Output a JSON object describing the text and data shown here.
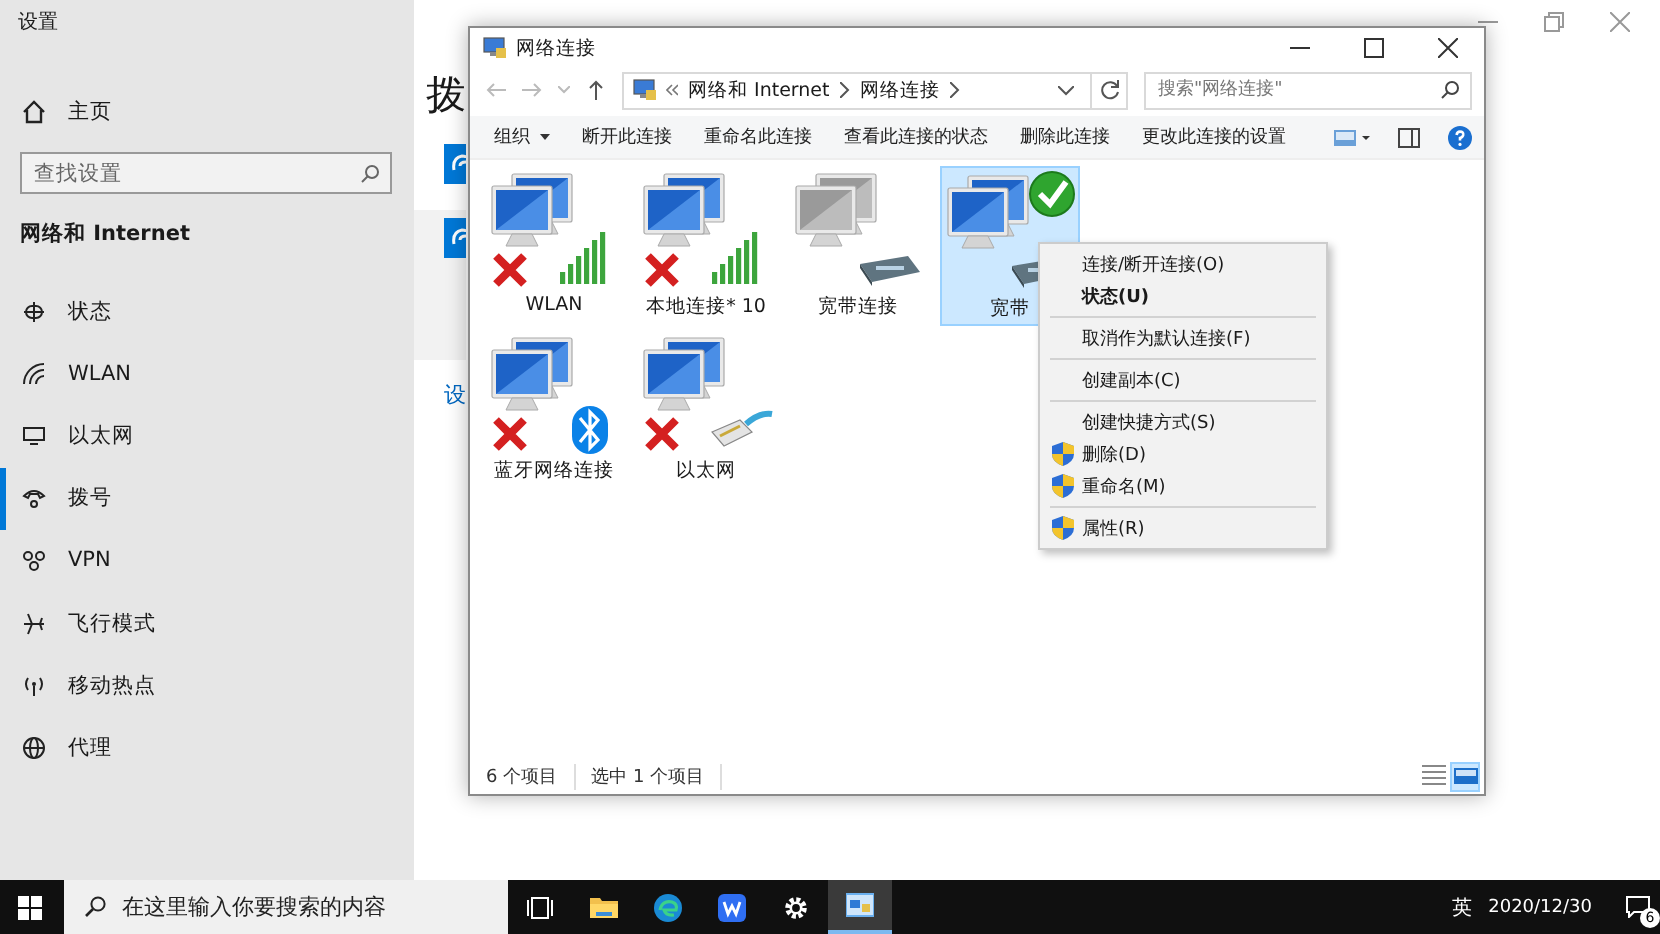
{
  "settings": {
    "title": "设置",
    "home": "主页",
    "search": {
      "placeholder": "查找设置"
    },
    "section": "网络和 Internet",
    "nav": [
      {
        "label": "状态",
        "selected": false
      },
      {
        "label": "WLAN",
        "selected": false
      },
      {
        "label": "以太网",
        "selected": false
      },
      {
        "label": "拨号",
        "selected": true
      },
      {
        "label": "VPN",
        "selected": false
      },
      {
        "label": "飞行模式",
        "selected": false
      },
      {
        "label": "移动热点",
        "selected": false
      },
      {
        "label": "代理",
        "selected": false
      }
    ],
    "page_heading": "拨",
    "link": "设"
  },
  "explorer": {
    "title": "网络连接",
    "address": [
      "网络和 Internet",
      "网络连接"
    ],
    "search": {
      "placeholder": "搜索\"网络连接\""
    },
    "toolbar": [
      "组织",
      "断开此连接",
      "重命名此连接",
      "查看此连接的状态",
      "删除此连接",
      "更改此连接的设置"
    ],
    "items": [
      {
        "label": "WLAN",
        "kind": "wifi",
        "connected": false,
        "disabled": false,
        "selected": false
      },
      {
        "label": "本地连接* 10",
        "kind": "wifi",
        "connected": false,
        "disabled": false,
        "selected": false
      },
      {
        "label": "宽带连接",
        "kind": "modem",
        "connected": false,
        "disabled": true,
        "selected": false
      },
      {
        "label": "宽带",
        "kind": "modem",
        "connected": true,
        "disabled": false,
        "selected": true
      },
      {
        "label": "蓝牙网络连接",
        "kind": "bluetooth",
        "connected": false,
        "disabled": false,
        "selected": false
      },
      {
        "label": "以太网",
        "kind": "ethernet",
        "connected": false,
        "disabled": false,
        "selected": false
      }
    ],
    "status_bar": [
      "6 个项目",
      "选中 1 个项目"
    ],
    "views": [
      {
        "kind": "details",
        "selected": false
      },
      {
        "kind": "large",
        "selected": true
      }
    ]
  },
  "context_menu": [
    {
      "label": "连接/断开连接(O)",
      "bold": false,
      "shield": false,
      "separator_after": false
    },
    {
      "label": "状态(U)",
      "bold": true,
      "shield": false,
      "separator_after": true
    },
    {
      "label": "取消作为默认连接(F)",
      "bold": false,
      "shield": false,
      "separator_after": true
    },
    {
      "label": "创建副本(C)",
      "bold": false,
      "shield": false,
      "separator_after": true
    },
    {
      "label": "创建快捷方式(S)",
      "bold": false,
      "shield": false,
      "separator_after": false
    },
    {
      "label": "删除(D)",
      "bold": false,
      "shield": true,
      "separator_after": false
    },
    {
      "label": "重命名(M)",
      "bold": false,
      "shield": true,
      "separator_after": true
    },
    {
      "label": "属性(R)",
      "bold": false,
      "shield": true,
      "separator_after": false
    }
  ],
  "taskbar": {
    "search": {
      "placeholder": "在这里输入你要搜索的内容"
    },
    "apps": [
      {
        "kind": "taskview",
        "active": false
      },
      {
        "kind": "folder",
        "active": false
      },
      {
        "kind": "browser",
        "active": false
      },
      {
        "kind": "office",
        "active": false
      },
      {
        "kind": "gear",
        "active": false
      },
      {
        "kind": "network",
        "active": true
      }
    ],
    "language": "英",
    "date": "2020/12/30",
    "notifications": "6"
  }
}
